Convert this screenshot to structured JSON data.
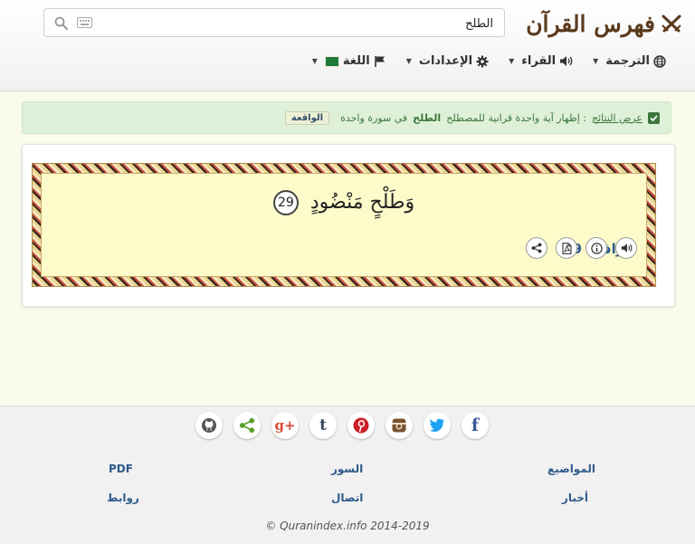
{
  "header": {
    "logo_text": "فهرس القرآن",
    "search": {
      "value": "الطلح",
      "placeholder": ""
    },
    "nav": {
      "translation": "الترجمة",
      "reciters": "القراء",
      "settings": "الإعدادات",
      "language": "اللغة"
    }
  },
  "alert": {
    "show_results": "عرض النتائج",
    "message_prefix": ": إظهار آية واحدة قرانية للمصطلح",
    "term": "الطلح",
    "message_suffix": "في سورة واحدة",
    "sura_badge": "الواقعة"
  },
  "verse": {
    "text": "وَطَلْحٍ مَنْضُودٍ",
    "number": "29",
    "reference": "الواقعة 29"
  },
  "footer": {
    "links": {
      "topics": "المواضيع",
      "suras": "السور",
      "pdf": "PDF",
      "news": "أخبار",
      "contact": "اتصال",
      "links": "روابط"
    },
    "copyright": "© Quranindex.info 2014-2019"
  },
  "colors": {
    "logo": "#5a3a1c",
    "link": "#2f5a8a",
    "alert_bg": "#dff0d8",
    "alert_text": "#3c763d",
    "verse_bg": "#fefbca",
    "facebook": "#3b5998",
    "twitter": "#1da1f2",
    "instagram": "#7a5230",
    "pinterest": "#cb2027",
    "tumblr": "#35465c",
    "googleplus": "#dd4b39",
    "share": "#5aa02c",
    "github": "#333333"
  },
  "icons": {
    "logo": "crossed-swords-icon",
    "search": "search-icon",
    "keyboard": "keyboard-icon",
    "translation": "globe-icon",
    "reciters": "speaker-icon",
    "settings": "gear-icon",
    "language": "flag-icon",
    "verse_actions": [
      "speaker-icon",
      "info-icon",
      "pdf-icon",
      "share-icon"
    ],
    "social": [
      "github-icon",
      "share-icon",
      "googleplus-icon",
      "tumblr-icon",
      "pinterest-icon",
      "instagram-icon",
      "twitter-icon",
      "facebook-icon"
    ]
  }
}
